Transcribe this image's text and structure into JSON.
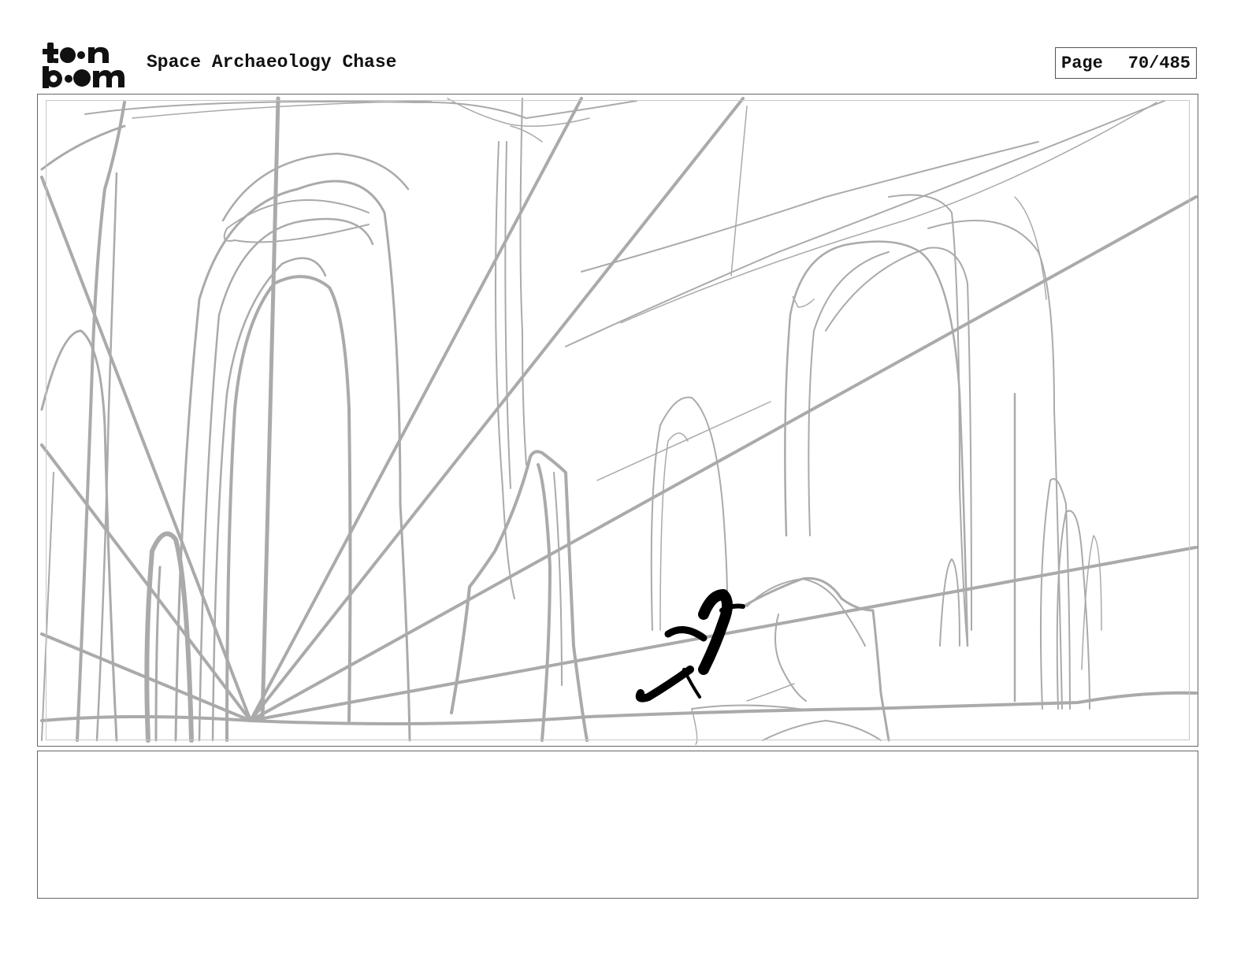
{
  "header": {
    "logo_icon": "toonboom-logo",
    "project_title": "Space Archaeology Chase",
    "page_label": "Page",
    "page_number": "70/485"
  },
  "panel": {
    "sketch_color": "#aaaaaa",
    "figure_color": "#000000"
  },
  "notes": {
    "text": ""
  }
}
